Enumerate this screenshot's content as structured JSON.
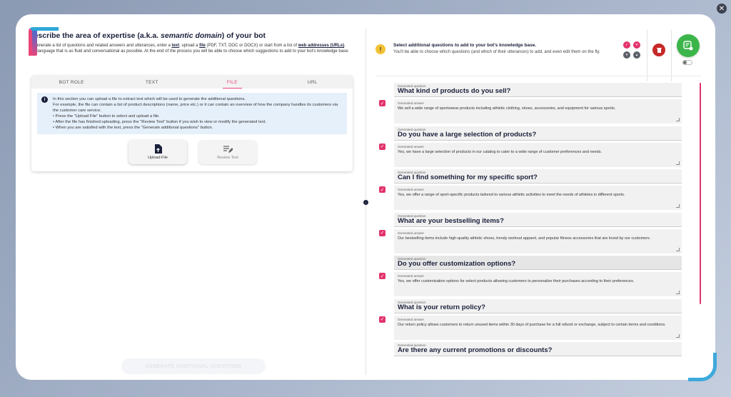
{
  "left": {
    "title_start": "Describe the area of expertise (a.k.a. ",
    "title_em": "semantic domain",
    "title_end": ") of your bot",
    "intro_1": "To generate a list of questions and related answers and utterances, enter a ",
    "intro_text": "text",
    "intro_2": ", upload a ",
    "intro_file": "file",
    "intro_3": " (PDF, TXT, DOC or DOCX) or start from a list of ",
    "intro_web": "web addresses (URLs)",
    "intro_4": ". Use language that is as fluid and conversational as possible. At the end of the process you will be able to choose which suggestions to add to your bot's knowledge base.",
    "tabs": [
      "BOT ROLE",
      "TEXT",
      "FILE",
      "URL"
    ],
    "info_lines": [
      "In this section you can upload a file to extract text which will be used to generate the additional questions.",
      "For example, the file can contain a list of product descriptions (name, price etc.) or it can contain an overview of how the company handles its customers via the customer care service.",
      "• Press the \"Upload File\" button to select and upload a file.",
      "• After the file has finished uploading, press the \"Review Text\" button if you wish to view or modify the generated text.",
      "• When you are satisfied with the text, press the \"Generate additional questions\" button."
    ],
    "upload_label": "Upload File",
    "review_label": "Review Text",
    "generate_label": "GENERATE ADDITIONAL QUESTIONS"
  },
  "right": {
    "title": "Select additional questions to add to your bot's knowledge base.",
    "subtitle": "You'll be able to choose which questions (and which of their utterances) to add, and even edit them on the fly.",
    "q_label": "Generated question",
    "a_label": "Generated answer",
    "questions": [
      {
        "q": "What kind of products do you sell?",
        "a": "We sell a wide range of sportswear products including athletic clothing, shoes, accessories, and equipment for various sports."
      },
      {
        "q": "Do you have a large selection of products?",
        "a": "Yes, we have a large selection of products in our catalog to cater to a wide range of customer preferences and needs."
      },
      {
        "q": "Can I find something for my specific sport?",
        "a": "Yes, we offer a range of sport-specific products tailored to various athletic activities to meet the needs of athletes in different sports."
      },
      {
        "q": "What are your bestselling items?",
        "a": "Our bestselling items include high-quality athletic shoes, trendy workout apparel, and popular fitness accessories that are loved by our customers."
      },
      {
        "q": "Do you offer customization options?",
        "a": "Yes, we offer customization options for select products allowing customers to personalize their purchases according to their preferences."
      },
      {
        "q": "What is your return policy?",
        "a": "Our return policy allows customers to return unused items within 30 days of purchase for a full refund or exchange, subject to certain terms and conditions."
      },
      {
        "q": "Are there any current promotions or discounts?",
        "a": ""
      }
    ]
  },
  "icons": {
    "close": "close-icon",
    "info": "info-icon",
    "warning": "warning-icon",
    "upload": "upload-file-icon",
    "review": "edit-text-icon",
    "trash": "trash-icon",
    "go": "add-to-knowledge-base-icon"
  },
  "colors": {
    "accent": "#e2336b",
    "success": "#3bb54a",
    "danger": "#c62828",
    "warning": "#f3c233",
    "navy": "#1a1f3a"
  }
}
